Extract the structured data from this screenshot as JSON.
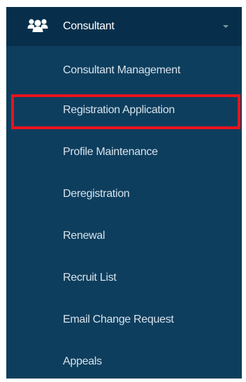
{
  "menu": {
    "header": {
      "icon": "users-group-icon",
      "label": "Consultant",
      "caret": "caret-down-icon"
    },
    "items": [
      {
        "label": "Consultant Management"
      },
      {
        "label": "Registration Application",
        "highlighted": true
      },
      {
        "label": "Profile Maintenance"
      },
      {
        "label": "Deregistration"
      },
      {
        "label": "Renewal"
      },
      {
        "label": "Recruit List"
      },
      {
        "label": "Email Change Request"
      },
      {
        "label": "Appeals"
      }
    ]
  },
  "colors": {
    "sidebar_bg": "#0e3e5e",
    "header_bg": "#072f4b",
    "text": "#d6e2eb",
    "highlight": "#e8141b"
  }
}
